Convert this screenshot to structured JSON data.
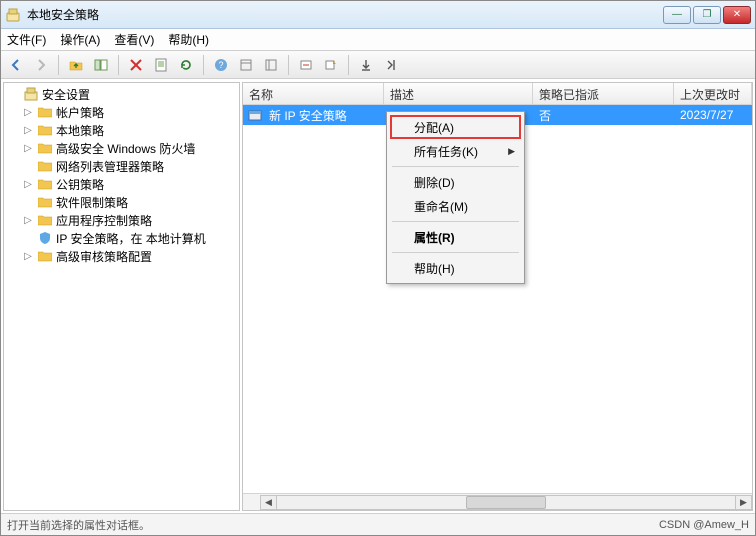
{
  "window": {
    "title": "本地安全策略"
  },
  "menu": {
    "file": "文件(F)",
    "action": "操作(A)",
    "view": "查看(V)",
    "help": "帮助(H)"
  },
  "tree": {
    "root": "安全设置",
    "items": [
      "帐户策略",
      "本地策略",
      "高级安全 Windows 防火墙",
      "网络列表管理器策略",
      "公钥策略",
      "软件限制策略",
      "应用程序控制策略",
      "IP 安全策略，在 本地计算机",
      "高级审核策略配置"
    ]
  },
  "columns": {
    "c0": "名称",
    "c1": "描述",
    "c2": "策略已指派",
    "c3": "上次更改时间"
  },
  "row": {
    "name": "新 IP 安全策略",
    "desc": "",
    "assigned": "否",
    "date": "2023/7/27"
  },
  "context": {
    "assign": "分配(A)",
    "alltasks": "所有任务(K)",
    "delete": "删除(D)",
    "rename": "重命名(M)",
    "properties": "属性(R)",
    "help": "帮助(H)"
  },
  "status": {
    "left": "打开当前选择的属性对话框。",
    "right": "CSDN @Amew_H"
  }
}
